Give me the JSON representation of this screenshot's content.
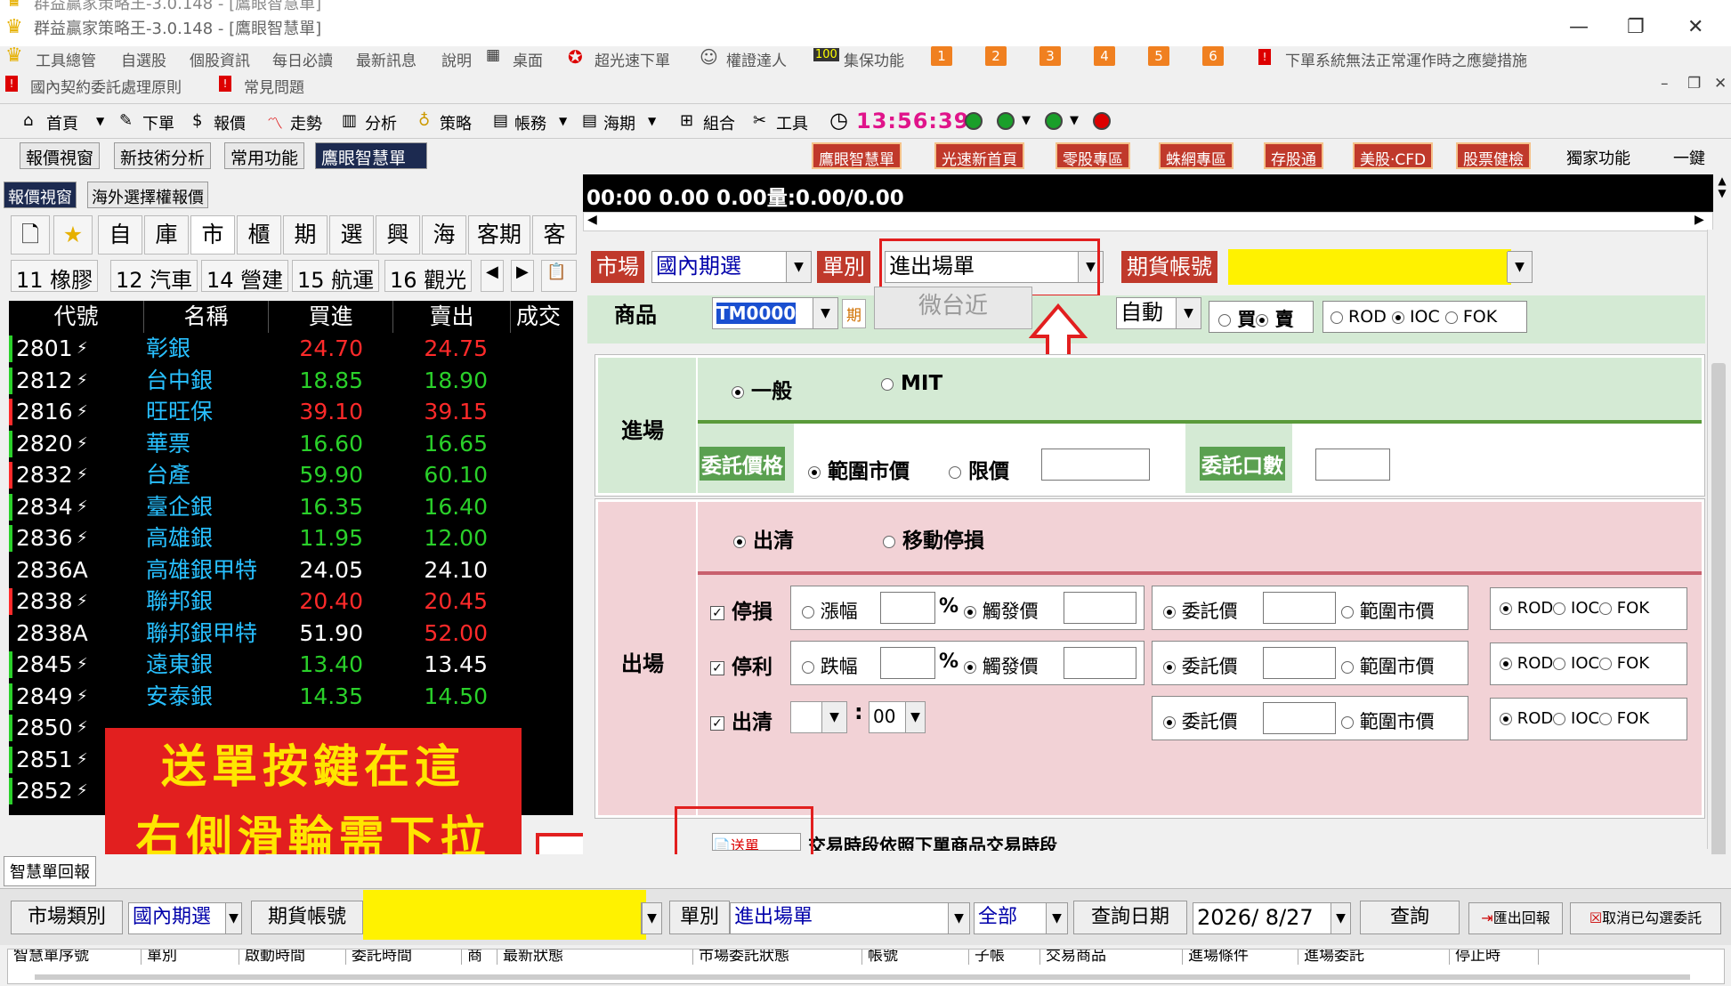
{
  "window": {
    "title_prev": "群益贏家策略王-3.0.148 - [鷹眼智慧單]",
    "title": "群益贏家策略王-3.0.148 - [鷹眼智慧單]"
  },
  "menu1": [
    "工具總管",
    "自選股",
    "個股資訊",
    "每日必讀",
    "最新訊息",
    "說明",
    "桌面",
    "超光速下單",
    "權證達人",
    "集保功能"
  ],
  "menu1_nums": [
    "1",
    "2",
    "3",
    "4",
    "5",
    "6"
  ],
  "menu1_notice": "下單系統無法正常運作時之應變措施",
  "menu2": [
    "國內契約委託處理原則",
    "常見問題"
  ],
  "toolbar": [
    "首頁",
    "下單",
    "報價",
    "走勢",
    "分析",
    "策略",
    "帳務",
    "海期",
    "組合",
    "工具"
  ],
  "clock": "13:56:39",
  "tabs2": [
    "報價視窗",
    "新技術分析",
    "常用功能",
    "鷹眼智慧單"
  ],
  "promos": [
    "鷹眼智慧單",
    "光速新首頁",
    "零股專區",
    "蛛網專區",
    "存股通",
    "美股‧CFD",
    "股票健檢",
    "獨家功能",
    "一鍵"
  ],
  "left": {
    "tabs": [
      "報價視窗",
      "海外選擇權報價"
    ],
    "cats": [
      "自",
      "庫",
      "市",
      "櫃",
      "期",
      "選",
      "興",
      "海",
      "客期",
      "客選"
    ],
    "industries": [
      "11 橡膠",
      "12 汽車",
      "14 營建",
      "15 航運",
      "16 觀光"
    ],
    "headers": [
      "代號",
      "名稱",
      "買進",
      "賣出",
      "成交"
    ],
    "rows": [
      {
        "code": "2801",
        "name": "彰銀",
        "bid": "24.70",
        "ask": "24.75",
        "bc": "r",
        "ac": "r",
        "m": "g"
      },
      {
        "code": "2812",
        "name": "台中銀",
        "bid": "18.85",
        "ask": "18.90",
        "bc": "g",
        "ac": "g",
        "m": "g"
      },
      {
        "code": "2816",
        "name": "旺旺保",
        "bid": "39.10",
        "ask": "39.15",
        "bc": "r",
        "ac": "r",
        "m": "r"
      },
      {
        "code": "2820",
        "name": "華票",
        "bid": "16.60",
        "ask": "16.65",
        "bc": "g",
        "ac": "g",
        "m": "g"
      },
      {
        "code": "2832",
        "name": "台產",
        "bid": "59.90",
        "ask": "60.10",
        "bc": "g",
        "ac": "g",
        "m": "r"
      },
      {
        "code": "2834",
        "name": "臺企銀",
        "bid": "16.35",
        "ask": "16.40",
        "bc": "g",
        "ac": "g",
        "m": "g"
      },
      {
        "code": "2836",
        "name": "高雄銀",
        "bid": "11.95",
        "ask": "12.00",
        "bc": "g",
        "ac": "g",
        "m": "g"
      },
      {
        "code": "2836A",
        "name": "高雄銀甲特",
        "bid": "24.05",
        "ask": "24.10",
        "bc": "w",
        "ac": "w",
        "m": ""
      },
      {
        "code": "2838",
        "name": "聯邦銀",
        "bid": "20.40",
        "ask": "20.45",
        "bc": "r",
        "ac": "r",
        "m": "r"
      },
      {
        "code": "2838A",
        "name": "聯邦銀甲特",
        "bid": "51.90",
        "ask": "52.00",
        "bc": "w",
        "ac": "r",
        "m": ""
      },
      {
        "code": "2845",
        "name": "遠東銀",
        "bid": "13.40",
        "ask": "13.45",
        "bc": "g",
        "ac": "w",
        "m": "g"
      },
      {
        "code": "2849",
        "name": "安泰銀",
        "bid": "14.35",
        "ask": "14.50",
        "bc": "g",
        "ac": "g",
        "m": "g"
      },
      {
        "code": "2850",
        "name": "",
        "bid": "",
        "ask": "",
        "bc": "w",
        "ac": "w",
        "m": "g"
      },
      {
        "code": "2851",
        "name": "",
        "bid": "",
        "ask": "",
        "bc": "w",
        "ac": "w",
        "m": "g"
      },
      {
        "code": "2852",
        "name": "",
        "bid": "",
        "ask": "",
        "bc": "w",
        "ac": "w",
        "m": "g"
      }
    ]
  },
  "overlay": {
    "line1": "送單按鍵在這",
    "line2": "右側滑輪需下拉"
  },
  "ticker": "00:00    0.00 0.00量:0.00/0.00",
  "form": {
    "market_label": "市場",
    "market_value": "國內期選",
    "type_label": "單別",
    "type_value": "進出場單",
    "account_label": "期貨帳號",
    "product_label": "商品",
    "product_value": "TM0000",
    "period_btn": "期",
    "near_btn": "微台近",
    "auto_value": "自動",
    "buy": "買",
    "sell": "賣",
    "rod": "ROD",
    "ioc": "IOC",
    "fok": "FOK",
    "entry_label": "進場",
    "general": "一般",
    "mit": "MIT",
    "price_label": "委託價格",
    "range_mkt": "範圍市價",
    "limit": "限價",
    "qty_label": "委託口數",
    "exit_label": "出場",
    "clear": "出清",
    "trailing": "移動停損",
    "stoploss": "停損",
    "takeprofit": "停利",
    "exitclear": "出清",
    "rise": "漲幅",
    "fall": "跌幅",
    "pct": "%",
    "trigger": "觸發價",
    "order_price": "委託價",
    "range_price": "範圍市價",
    "minute": "00",
    "send_hint": "交易時段依照下單商品交易時段"
  },
  "bottom": {
    "tab": "智慧單回報",
    "market_label": "市場類別",
    "market_value": "國內期選",
    "account_label": "期貨帳號",
    "type_label": "單別",
    "type_value": "進出場單",
    "all": "全部",
    "date_label": "查詢日期",
    "date_value": "2026/  8/27",
    "query": "查詢",
    "export": "匯出回報",
    "cancel": "取消已勾選委託",
    "cols": [
      "智慧單序號",
      "單別",
      "啟動時間",
      "委託時間",
      "商",
      "最新狀態",
      "市場委託狀態",
      "帳號",
      "子帳",
      "交易商品",
      "進場條件",
      "進場委託",
      "停止時"
    ]
  },
  "colors": {
    "accent_red": "#e21f1f",
    "highlight_yellow": "#fff200",
    "panel_green": "#d4ead4",
    "panel_pink": "#f2d2d6"
  }
}
